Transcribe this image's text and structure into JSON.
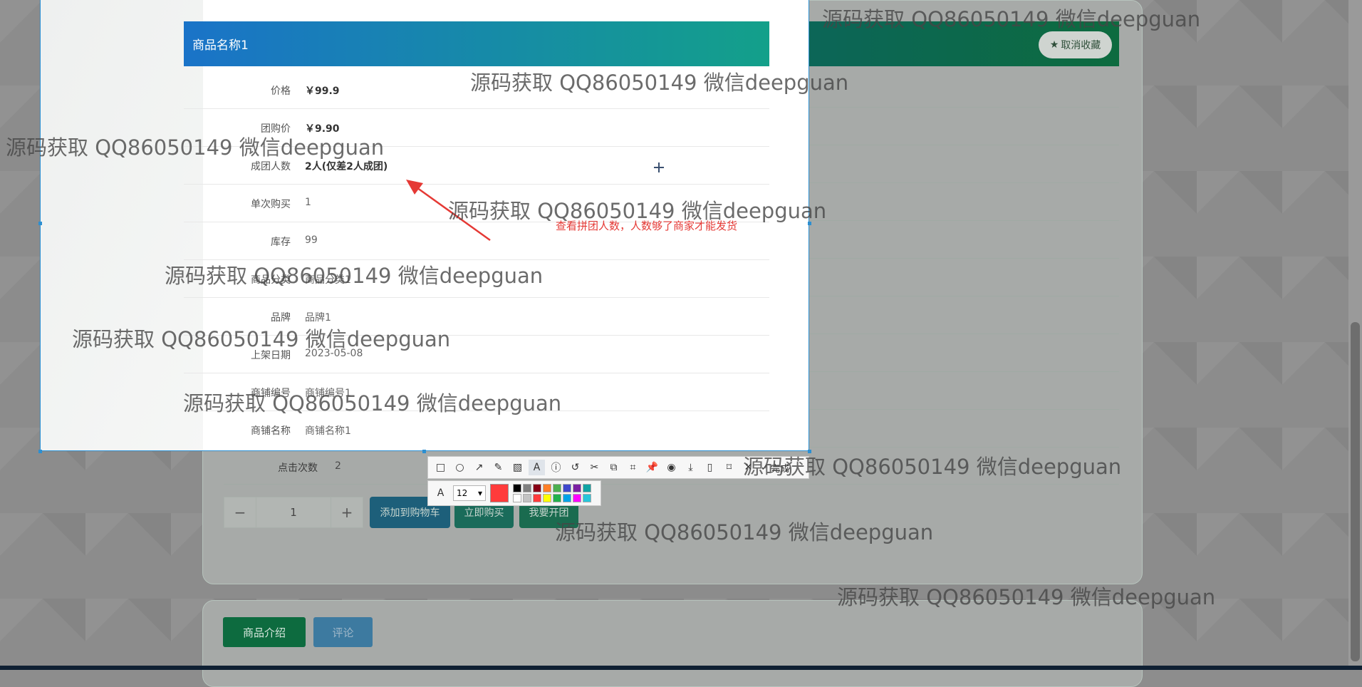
{
  "product": {
    "title": "商品名称1",
    "favorite_label": "取消收藏",
    "rows": [
      {
        "label": "价格",
        "value": "￥99.9",
        "strong": true
      },
      {
        "label": "团购价",
        "value": "￥9.90",
        "strong": true
      },
      {
        "label": "成团人数",
        "value": "2人(仅差2人成团)",
        "strong": true
      },
      {
        "label": "单次购买",
        "value": "1"
      },
      {
        "label": "库存",
        "value": "99"
      },
      {
        "label": "商品分类",
        "value": "商品分类1"
      },
      {
        "label": "品牌",
        "value": "品牌1"
      },
      {
        "label": "上架日期",
        "value": "2023-05-08"
      },
      {
        "label": "商铺编号",
        "value": "商铺编号1"
      },
      {
        "label": "商铺名称",
        "value": "商铺名称1"
      },
      {
        "label": "点击次数",
        "value": "2"
      }
    ],
    "quantity": {
      "minus": "−",
      "value": "1",
      "plus": "+"
    },
    "actions": {
      "add_to_cart": "添加到购物车",
      "buy_now": "立即购买",
      "group_buy": "我要开团"
    }
  },
  "tabs": {
    "intro": "商品介绍",
    "comments": "评论"
  },
  "annotation": {
    "text": "查看拼团人数，人数够了商家才能发货",
    "color": "#e53935"
  },
  "capture_toolbar": {
    "tools": [
      "rectangle-icon",
      "ellipse-icon",
      "arrow-icon",
      "pencil-icon",
      "mosaic-icon",
      "text-icon",
      "info-icon",
      "undo-icon",
      "cut-icon",
      "copy-icon",
      "crop-icon",
      "pin-icon",
      "record-icon",
      "save-icon",
      "phone-icon",
      "bookmark-icon",
      "close-icon"
    ],
    "done_label": "完成",
    "font_size": "12",
    "current_color": "#ff3b3b",
    "palette": [
      "#000000",
      "#7f7f7f",
      "#880015",
      "#ff7f27",
      "#4caf50",
      "#3f48cc",
      "#7b1fa2",
      "#0fa3a3",
      "#ffffff",
      "#c3c3c3",
      "#ff3b3b",
      "#ffff00",
      "#22b14c",
      "#00a2e8",
      "#ff00ff",
      "#26c6da"
    ]
  },
  "watermark_text": "源码获取 QQ86050149 微信deepguan"
}
